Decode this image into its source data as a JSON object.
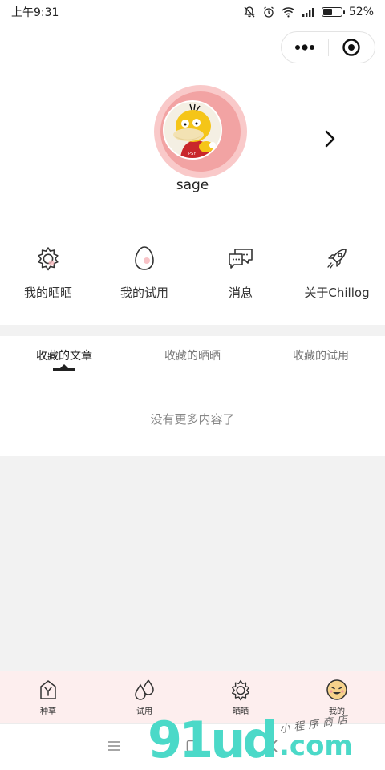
{
  "status_bar": {
    "time": "上午9:31",
    "battery": "52%",
    "battery_level": 0.52
  },
  "capsule": {
    "more_icon": "more-dots-icon",
    "close_icon": "target-close-icon"
  },
  "profile": {
    "username": "sage",
    "avatar_icon": "duck-avatar",
    "arrow_icon": "chevron-right-icon"
  },
  "menu": {
    "items": [
      {
        "label": "我的晒晒",
        "icon": "sun-gear-icon"
      },
      {
        "label": "我的试用",
        "icon": "egg-icon"
      },
      {
        "label": "消息",
        "icon": "chat-bubbles-icon"
      },
      {
        "label": "关于Chillog",
        "icon": "rocket-icon"
      }
    ]
  },
  "tabs": {
    "items": [
      {
        "label": "收藏的文章",
        "active": true
      },
      {
        "label": "收藏的晒晒",
        "active": false
      },
      {
        "label": "收藏的试用",
        "active": false
      }
    ]
  },
  "empty_text": "没有更多内容了",
  "tabbar": {
    "items": [
      {
        "label": "种草",
        "icon": "sprout-icon"
      },
      {
        "label": "试用",
        "icon": "drops-icon"
      },
      {
        "label": "晒晒",
        "icon": "sun-gear-icon"
      },
      {
        "label": "我的",
        "icon": "face-icon"
      }
    ]
  },
  "watermark": {
    "brand": "91ud",
    "suffix": ".com",
    "tagline": "小程序商店"
  },
  "colors": {
    "ring_outer": "#f9c9c9",
    "ring_inner": "#f2a3a3",
    "tabbar_bg": "#fdeeee",
    "grey_bg": "#f2f2f2",
    "watermark": "#4bd9c8"
  }
}
